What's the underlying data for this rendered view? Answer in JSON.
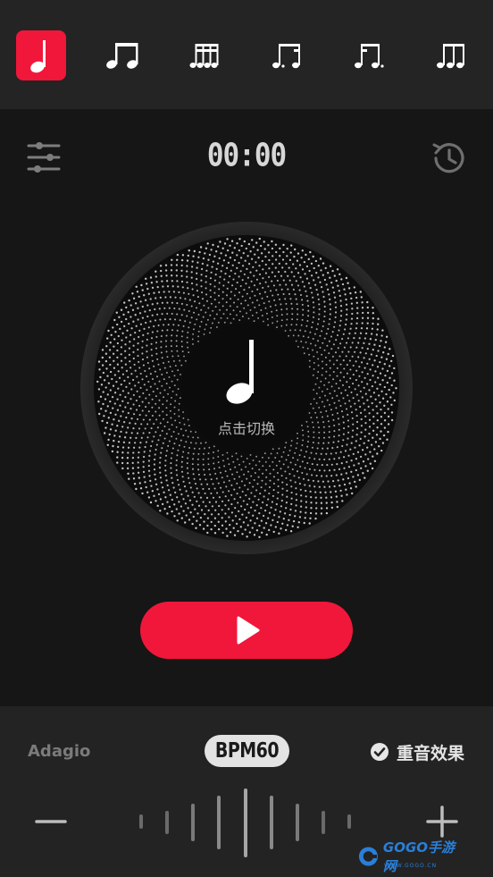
{
  "note_tabs": [
    {
      "name": "quarter",
      "active": true
    },
    {
      "name": "eighths"
    },
    {
      "name": "sixteenths"
    },
    {
      "name": "dotted-eighth-sixteenth"
    },
    {
      "name": "sixteenth-dotted-eighth"
    },
    {
      "name": "triplet"
    }
  ],
  "toolbar": {
    "timer": "00:00",
    "settings_icon": "sliders-icon",
    "history_icon": "history-icon"
  },
  "dial": {
    "label": "点击切换",
    "note_icon": "quarter-note-icon"
  },
  "controls": {
    "play_icon": "play-icon"
  },
  "bottom": {
    "tempo_name": "Adagio",
    "bpm_label": "BPM60",
    "accent_label": "重音效果",
    "accent_checked": true
  },
  "watermark": {
    "text": "GOGO手游网",
    "sub": "WWW.GOGO.CN"
  },
  "colors": {
    "accent": "#f0173b",
    "background": "#161616",
    "bar": "#242424"
  }
}
